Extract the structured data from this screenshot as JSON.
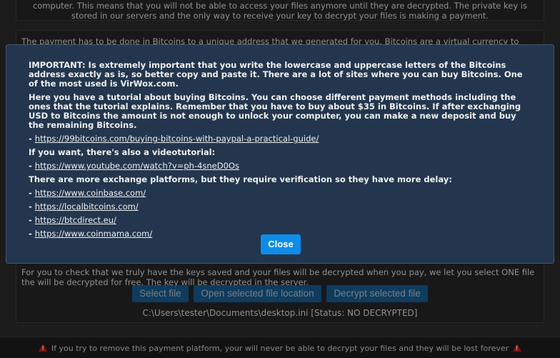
{
  "top_panel": {
    "line1": "computer. This means that you will not be able to access your files anymore until they are decrypted. The private key is",
    "line2": "stored in our servers and the only way to receive your key to decrypt your files is making a payment."
  },
  "payment_panel": {
    "intro": "The payment has to be done in Bitcoins to a unique address that we generated for you. Bitcoins are a virtual currency to",
    "check_text": "For you to check that we truly have the keys saved and your files will be decrypted when you pay, we let you select ONE file the will be decrypted for free. The key will be decrypted in the server.",
    "select_file_label": "Select file",
    "open_location_label": "Open selected file location",
    "decrypt_label": "Decrypt selected file",
    "file_path": "C:\\Users\\tester\\Documents\\desktop.ini [Status: NO DECRYPTED]"
  },
  "footer": {
    "warning_text": "If you try to remove this payment platform, your will never be able to decrypt your files and they will be lost forever",
    "warning_icon": "warning-triangle-icon",
    "warning_color": "#d11a1a"
  },
  "modal": {
    "important": "IMPORTANT: Is extremely important that you write the lowercase and uppercase letters of the Bitcoins address exactly as is, so better copy and paste it. There are a lot of sites where you can buy Bitcoins. One of the most used is VirWox.com.",
    "tutorial_intro": "Here you have a tutorial about buying Bitcoins. You can choose different payment methods including the ones that the tutorial explains. Remember that you have to buy about $35 in Bitcoins. If after exchanging USD to Bitcoins the amount is not enough to unlock your computer, you can make a new deposit and buy the remaining Bitcoins.",
    "tutorial_link": "https://99bitcoins.com/buying-bitcoins-with-paypal-a-practical-guide/",
    "video_intro": "If you want, there's also a videotutorial:",
    "video_link": "https://www.youtube.com/watch?v=ph-4sneD0Os",
    "exchanges_intro": "There are more exchange platforms, but they require verification so they have more delay:",
    "exchanges": [
      "https://www.coinbase.com/",
      "https://localbitcoins.com/",
      "https://btcdirect.eu/",
      "https://www.coinmama.com/"
    ],
    "close_label": "Close",
    "accent": "#0d8de8"
  }
}
